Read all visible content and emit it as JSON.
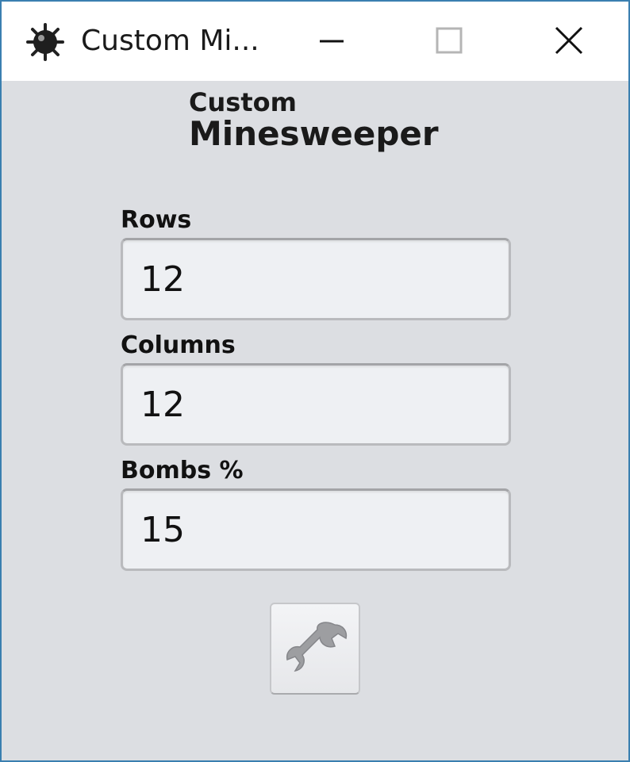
{
  "window": {
    "title": "Custom Mi...",
    "controls": {
      "minimize_icon": "minimize-icon",
      "maximize_icon": "maximize-icon",
      "close_icon": "close-icon"
    }
  },
  "heading": {
    "line1": "Custom",
    "line2": "Minesweeper"
  },
  "fields": [
    {
      "label": "Rows",
      "value": "12"
    },
    {
      "label": "Columns",
      "value": "12"
    },
    {
      "label": "Bombs %",
      "value": "15"
    }
  ],
  "actions": {
    "apply_icon": "wrench-icon"
  },
  "colors": {
    "window_border": "#3a7fb0",
    "client_background": "#dcdee2",
    "input_background": "#eef0f3"
  }
}
